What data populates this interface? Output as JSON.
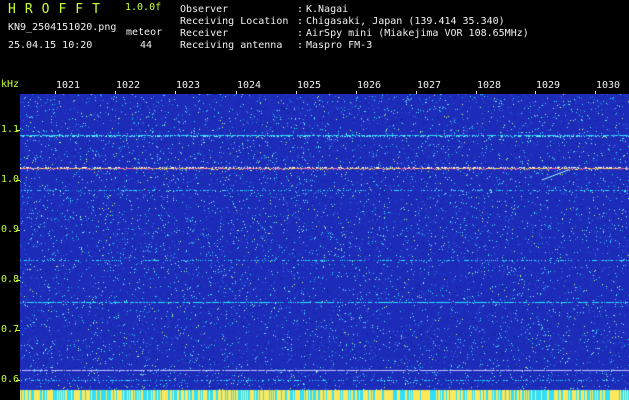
{
  "header": {
    "title": "HROFFT",
    "version": "1.0.0f",
    "filename": "KN9_2504151020.png",
    "mode": "meteor",
    "datetime": "25.04.15 10:20",
    "count": "44"
  },
  "info": [
    {
      "label": "Observer",
      "value": "K.Nagai"
    },
    {
      "label": "Receiving Location",
      "value": "Chigasaki, Japan (139.414 35.340)"
    },
    {
      "label": "Receiver",
      "value": "AirSpy mini (Miakejima VOR 108.65MHz)"
    },
    {
      "label": "Receiving antenna",
      "value": "Maspro FM-3"
    }
  ],
  "info_separator": ":",
  "axis": {
    "y_unit": "kHz",
    "y_ticks": [
      "1.1",
      "1.0",
      "0.9",
      "0.8",
      "0.7",
      "0.6"
    ],
    "x_ticks": [
      "1021",
      "1022",
      "1023",
      "1024",
      "1025",
      "1026",
      "1027",
      "1028",
      "1029",
      "1030"
    ]
  },
  "colors": {
    "header_green": "#c8ff32",
    "background_blue": "#1a2ab4",
    "noise_cyan": "#2ee0ff",
    "line_pink": "#ff6aa8",
    "carrier_yellow": "#ffe85a"
  }
}
